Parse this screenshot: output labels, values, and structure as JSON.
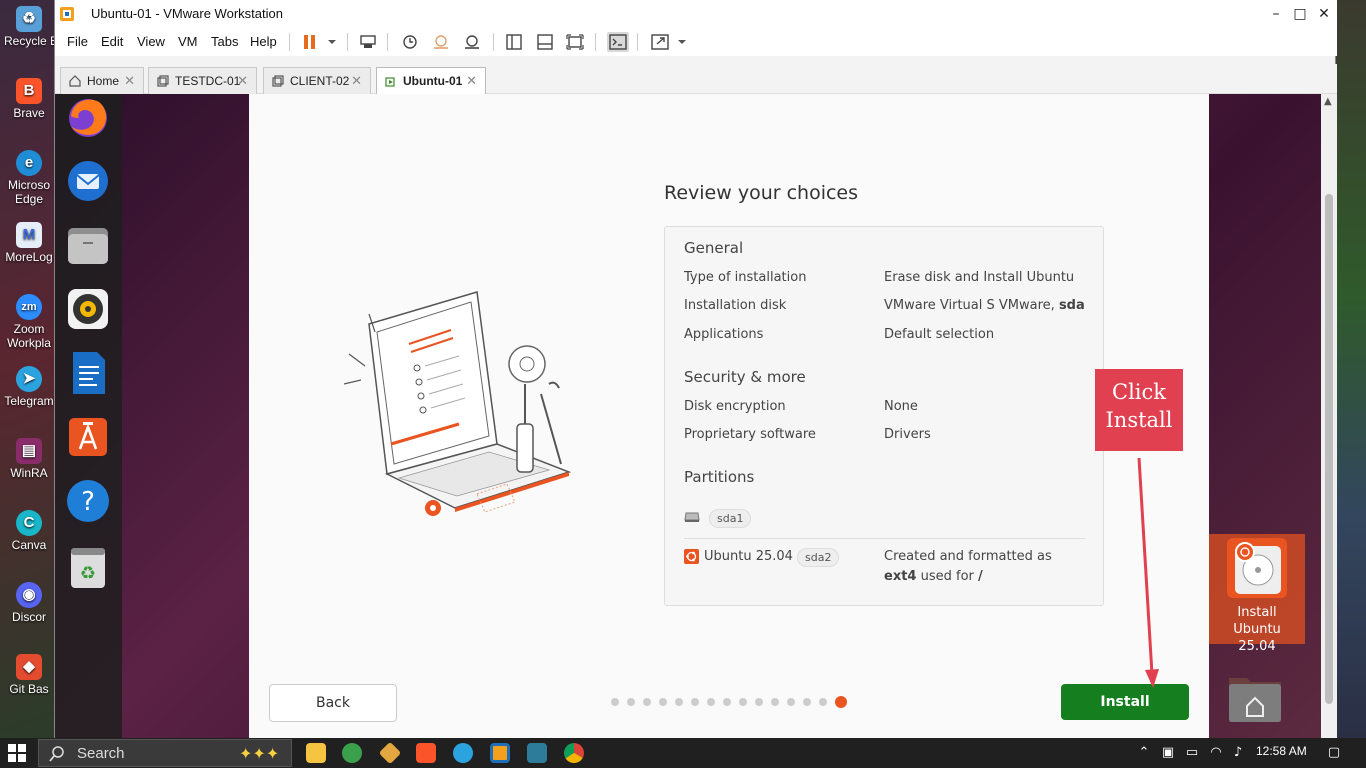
{
  "window": {
    "title": "Ubuntu-01 - VMware Workstation"
  },
  "menu": [
    "File",
    "Edit",
    "View",
    "VM",
    "Tabs",
    "Help"
  ],
  "tabs": [
    {
      "label": "Home",
      "active": false
    },
    {
      "label": "TESTDC-01",
      "active": false
    },
    {
      "label": "CLIENT-02",
      "active": false
    },
    {
      "label": "Ubuntu-01",
      "active": true
    }
  ],
  "desktop_icons": [
    "Recycle B",
    "Brave",
    "Microso Edge",
    "MoreLog",
    "Zoom Workpla",
    "Telegram",
    "WinRA",
    "Canva",
    "Discor",
    "Git Bas"
  ],
  "dock_apps": [
    "firefox-icon",
    "thunderbird-icon",
    "files-icon",
    "rhythmbox-icon",
    "writer-icon",
    "app-center-icon",
    "help-icon",
    "trash-icon"
  ],
  "installer": {
    "title": "Review your choices",
    "general": {
      "heading": "General",
      "rows": [
        {
          "key": "Type of installation",
          "value": "Erase disk and Install Ubuntu"
        },
        {
          "key": "Installation disk",
          "value_prefix": "VMware Virtual S VMware, ",
          "value_bold": "sda"
        },
        {
          "key": "Applications",
          "value": "Default selection"
        }
      ]
    },
    "security": {
      "heading": "Security & more",
      "rows": [
        {
          "key": "Disk encryption",
          "value": "None"
        },
        {
          "key": "Proprietary software",
          "value": "Drivers"
        }
      ]
    },
    "partitions": {
      "heading": "Partitions",
      "disk_chip": "sda1",
      "os_name": "Ubuntu 25.04",
      "os_chip": "sda2",
      "desc_line1": "Created and formatted as",
      "desc_bold_fs": "ext4",
      "desc_used_for": " used for ",
      "desc_mount": "/"
    },
    "back_label": "Back",
    "install_label": "Install",
    "progress": {
      "total_steps": 15,
      "current_step": 15
    }
  },
  "annotation": {
    "line1": "Click",
    "line2": "Install"
  },
  "guest_desktop": {
    "install_icon_label": "Install Ubuntu 25.04"
  },
  "taskbar": {
    "search_placeholder": "Search",
    "clock": "12:58 AM"
  },
  "colors": {
    "ubuntu_orange": "#e95420",
    "install_green": "#157f1f",
    "callout_red": "#e14050"
  }
}
